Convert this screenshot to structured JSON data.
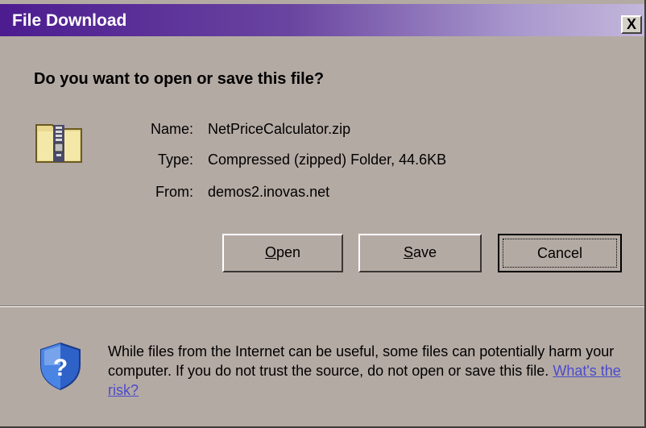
{
  "dialog": {
    "title": "File Download",
    "close_label": "X",
    "question": "Do you want to open or save this file?"
  },
  "file": {
    "name_label": "Name:",
    "name_value": "NetPriceCalculator.zip",
    "type_label": "Type:",
    "type_value": "Compressed (zipped) Folder, 44.6KB",
    "from_label": "From:",
    "from_value": "demos2.inovas.net"
  },
  "buttons": {
    "open": "Open",
    "save": "Save",
    "cancel": "Cancel"
  },
  "warning": {
    "text": "While files from the Internet can be useful, some files can potentially harm your computer. If you do not trust the source, do not open or save this file.",
    "link": "What's the risk?"
  },
  "icons": {
    "file_icon": "zip-folder-icon",
    "warning_icon": "shield-question-icon"
  },
  "colors": {
    "dialog_bg": "#b4aaa4",
    "titlebar_start": "#4c1c90",
    "titlebar_end": "#c3b7db",
    "link": "#4b4bcc"
  }
}
